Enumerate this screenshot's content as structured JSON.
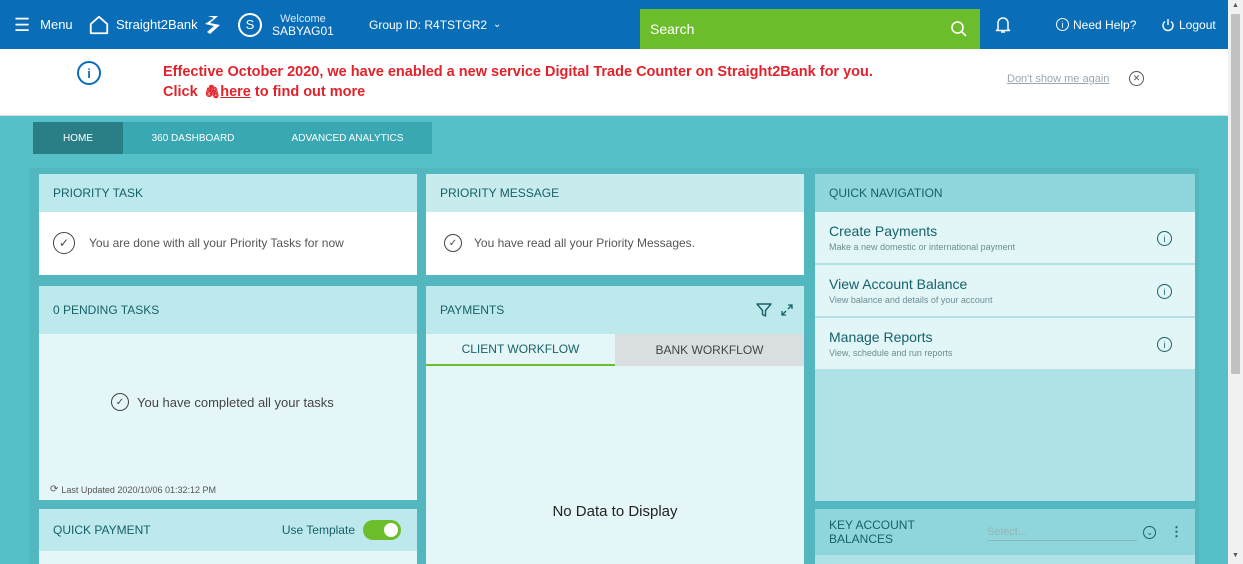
{
  "topbar": {
    "menu_label": "Menu",
    "brand_label": "Straight2Bank",
    "avatar_initial": "S",
    "welcome_label": "Welcome",
    "user_id": "SABYAG01",
    "group_label": "Group ID: R4TSTGR2",
    "search_placeholder": "Search",
    "help_label": "Need Help?",
    "logout_label": "Logout"
  },
  "announcement": {
    "message_line1": "Effective October 2020, we have enabled a new service Digital Trade Counter on Straight2Bank for you.",
    "click_label": "Click",
    "link_label": "here",
    "message_tail": "to find out more",
    "dismiss_label": "Don't show me again"
  },
  "tabs": [
    {
      "label": "HOME",
      "active": true
    },
    {
      "label": "360 DASHBOARD",
      "active": false
    },
    {
      "label": "ADVANCED ANALYTICS",
      "active": false
    }
  ],
  "priority_task": {
    "title": "PRIORITY TASK",
    "message": "You are done with all your Priority Tasks for now"
  },
  "priority_message": {
    "title": "PRIORITY MESSAGE",
    "message": "You have read all your Priority Messages."
  },
  "quick_navigation": {
    "title": "QUICK NAVIGATION",
    "items": [
      {
        "title": "Create Payments",
        "subtitle": "Make a new domestic or international payment"
      },
      {
        "title": "View Account Balance",
        "subtitle": "View balance and details of your account"
      },
      {
        "title": "Manage Reports",
        "subtitle": "View, schedule and run reports"
      }
    ]
  },
  "pending_tasks": {
    "title": "0 PENDING TASKS",
    "message": "You have completed all your tasks",
    "last_updated": "Last Updated 2020/10/06 01:32:12 PM"
  },
  "payments": {
    "title": "PAYMENTS",
    "tabs": [
      "CLIENT WORKFLOW",
      "BANK WORKFLOW"
    ],
    "empty_message": "No Data to Display"
  },
  "quick_payment": {
    "title": "QUICK PAYMENT",
    "template_label": "Use Template"
  },
  "key_account_balances": {
    "title": "KEY ACCOUNT BALANCES",
    "select_placeholder": "Select..."
  },
  "colors": {
    "topbar": "#0a6db8",
    "search": "#6cbd2c",
    "background": "#56c0c8",
    "alert_text": "#e1222a",
    "panel_header": "#bde9ec"
  }
}
